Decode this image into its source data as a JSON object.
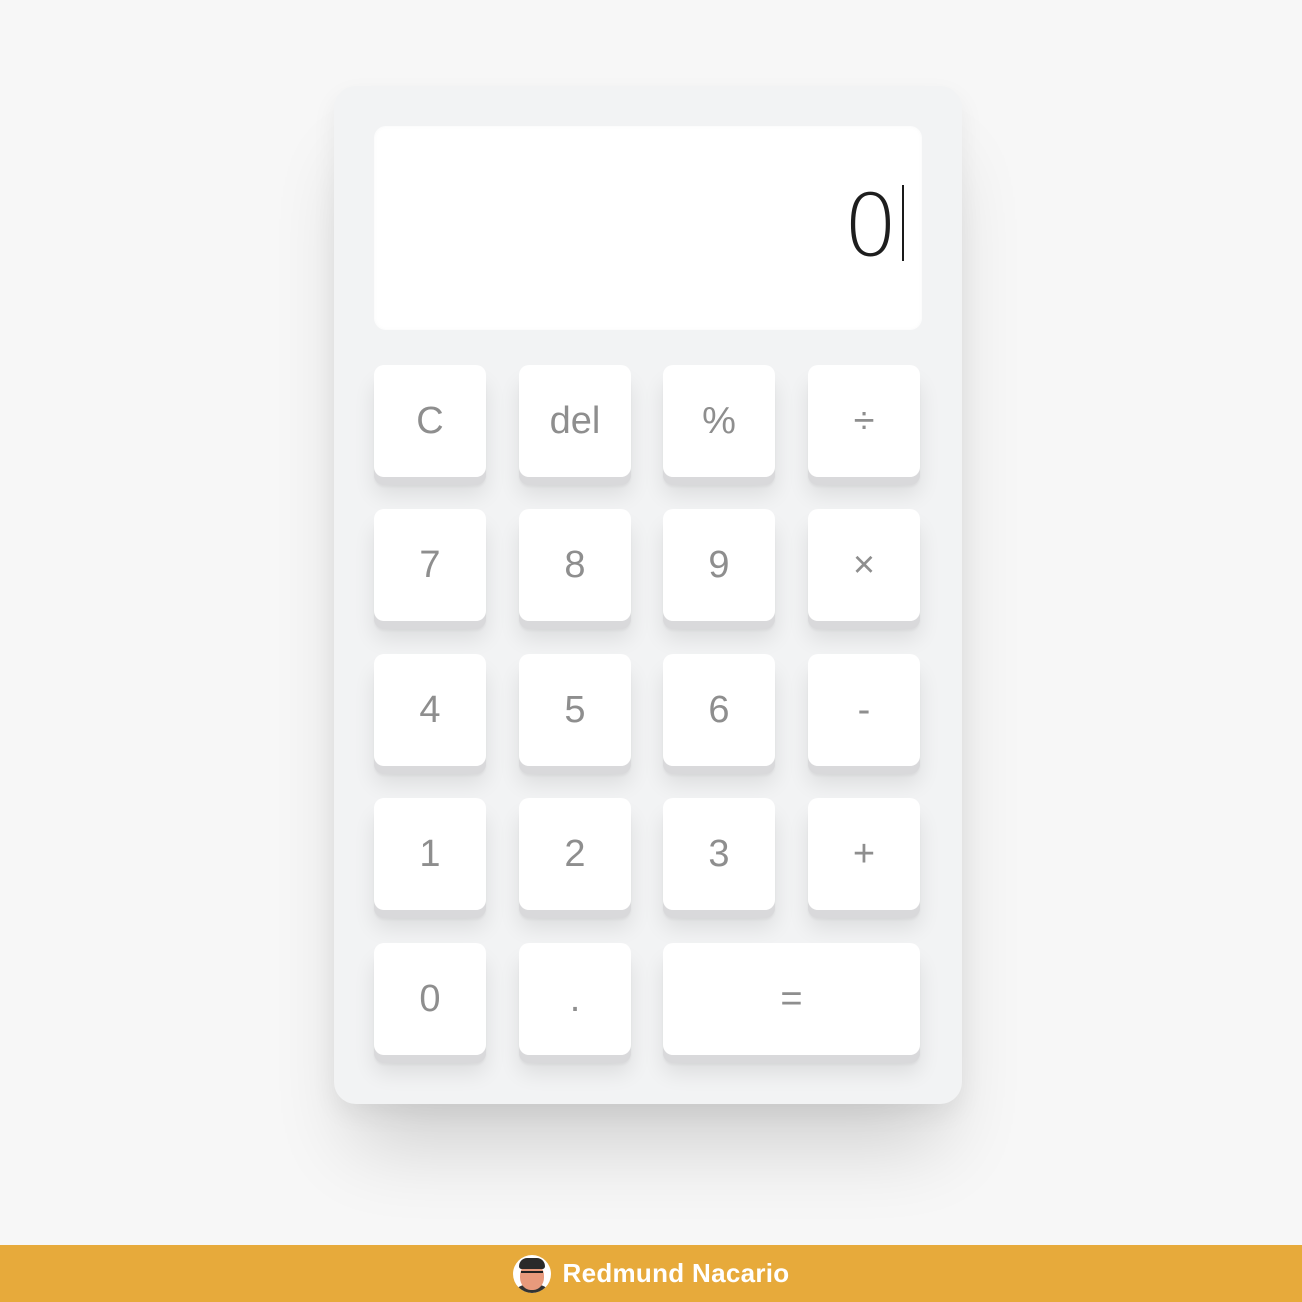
{
  "display": {
    "value": "0"
  },
  "keys": {
    "clear": "C",
    "delete": "del",
    "percent": "%",
    "divide": "÷",
    "seven": "7",
    "eight": "8",
    "nine": "9",
    "multiply": "×",
    "four": "4",
    "five": "5",
    "six": "6",
    "subtract": "-",
    "one": "1",
    "two": "2",
    "three": "3",
    "add": "+",
    "zero": "0",
    "decimal": ".",
    "equals": "="
  },
  "footer": {
    "author_name": "Redmund Nacario",
    "brand_color": "#e7aa3b"
  },
  "colors": {
    "background": "#f7f7f7",
    "body": "#f2f3f4",
    "key_face": "#ffffff",
    "key_label": "#8e8e8e",
    "display_text": "#1e1e1e"
  }
}
